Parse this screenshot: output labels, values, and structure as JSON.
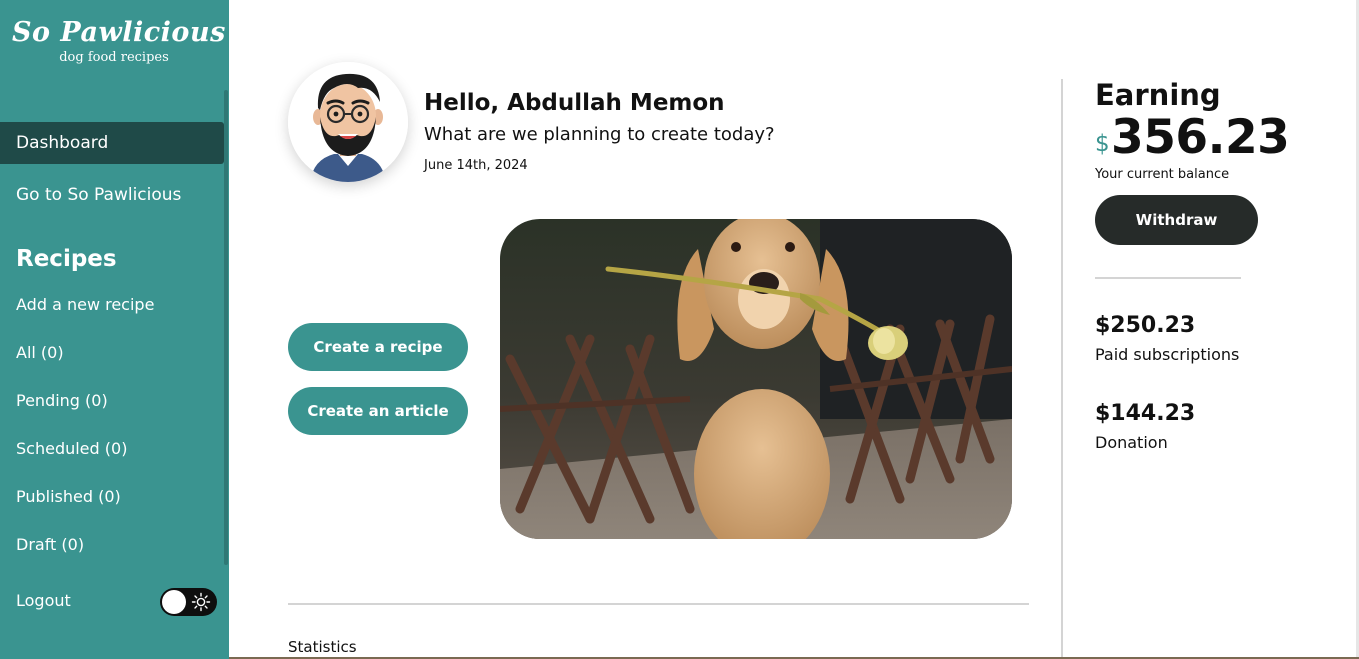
{
  "brand": {
    "name": "So Pawlicious",
    "tagline": "dog food recipes",
    "color": "#3a9490"
  },
  "sidebar": {
    "dashboard": "Dashboard",
    "go_to_site": "Go to So Pawlicious",
    "recipes_title": "Recipes",
    "links": {
      "add": "Add a new recipe",
      "all": "All (0)",
      "pending": "Pending (0)",
      "scheduled": "Scheduled (0)",
      "published": "Published (0)",
      "draft": "Draft (0)"
    },
    "logout": "Logout"
  },
  "header": {
    "greeting": "Hello, Abdullah Memon",
    "subtitle": "What are we planning to create today?",
    "date": "June 14th, 2024"
  },
  "actions": {
    "create_recipe": "Create a recipe",
    "create_article": "Create an article"
  },
  "statistics_label": "Statistics",
  "earning": {
    "title": "Earning",
    "currency": "$",
    "balance": "356.23",
    "balance_label": "Your current balance",
    "withdraw": "Withdraw",
    "subscriptions_amount": "$250.23",
    "subscriptions_label": "Paid subscriptions",
    "donation_amount": "$144.23",
    "donation_label": "Donation"
  },
  "icons": {
    "theme_toggle": "sun-icon"
  }
}
